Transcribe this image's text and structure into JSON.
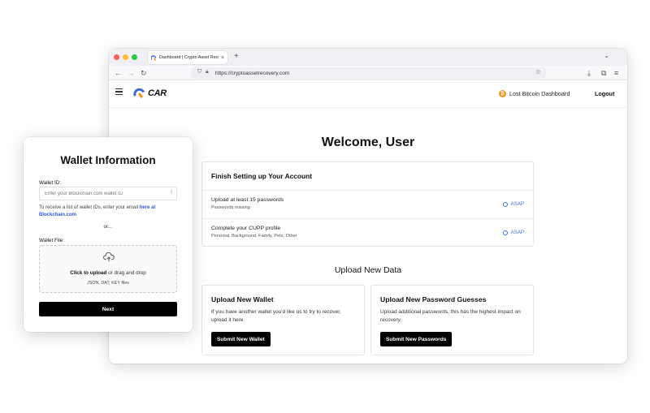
{
  "browser": {
    "tab_title": "Dashboard | Crypto Asset Reco",
    "tab_close": "×",
    "new_tab": "+",
    "url": "https://cryptoassetrecovery.com"
  },
  "header": {
    "logo_text": "CAR",
    "lost_bitcoin_label": "Lost Bitcoin Dashboard",
    "btc_symbol": "₿",
    "logout_label": "Logout"
  },
  "main": {
    "welcome": "Welcome, User",
    "setup": {
      "title": "Finish Setting up Your Account",
      "tasks": [
        {
          "title": "Upload at least 15 passwords",
          "subtitle": "Passwords missing",
          "badge": "ASAP"
        },
        {
          "title": "Complete your CUPP profile",
          "subtitle": "Personal, Background, Family, Pets, Other",
          "badge": "ASAP"
        }
      ]
    },
    "upload_title": "Upload New Data",
    "cards": [
      {
        "title": "Upload New Wallet",
        "text": "If you have another wallet you'd like us to try to recover, upload it here.",
        "button": "Submit New Wallet"
      },
      {
        "title": "Upload New Password Guesses",
        "text": "Upload additional passwords, this has the highest impact on recovery.",
        "button": "Submit New Passwords"
      }
    ]
  },
  "modal": {
    "title": "Wallet Information",
    "wallet_id_label": "Wallet ID:",
    "wallet_id_placeholder": "Enter your Blockchain.com wallet ID",
    "wallet_id_value": "",
    "hint_text": "To receive a list of wallet IDs, enter your email ",
    "hint_link": "here at Blockchain.com",
    "or_text": "or...",
    "wallet_file_label": "Wallet File:",
    "dropzone_click": "Click to upload",
    "dropzone_rest": " or drag and drop",
    "dropzone_types": "JSON, DAT, KEY files",
    "next_label": "Next"
  },
  "colors": {
    "accent_blue": "#3b6fd8",
    "btc_orange": "#f7931a",
    "button_black": "#000000"
  }
}
